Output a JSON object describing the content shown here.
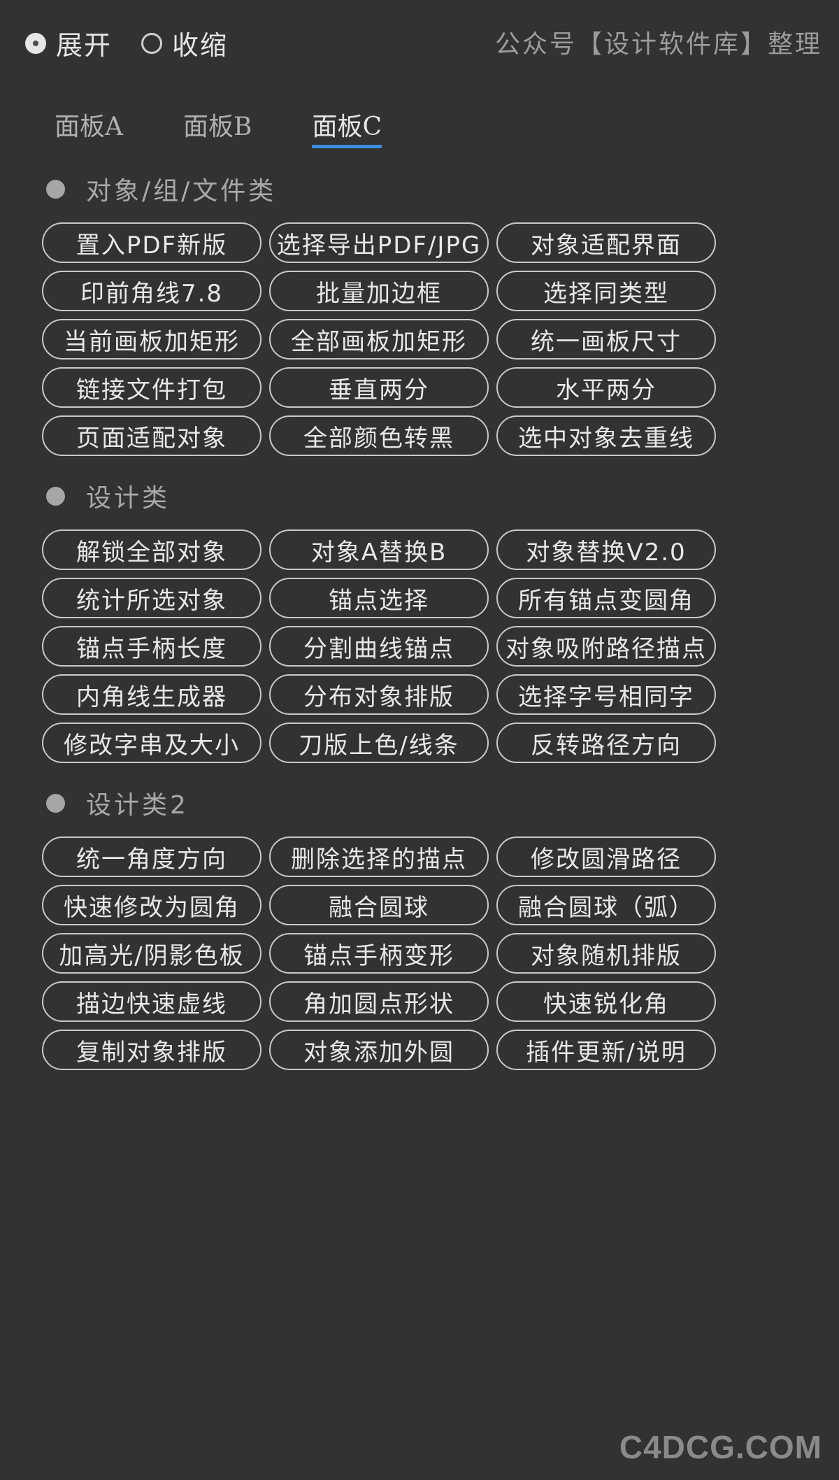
{
  "mode": {
    "expand_label": "展开",
    "collapse_label": "收缩",
    "selected": "expand"
  },
  "credit": "公众号【设计软件库】整理",
  "tabs": [
    {
      "label": "面板A",
      "active": false
    },
    {
      "label": "面板B",
      "active": false
    },
    {
      "label": "面板C",
      "active": true
    }
  ],
  "sections": [
    {
      "title": "对象/组/文件类",
      "buttons": [
        "置入PDF新版",
        "选择导出PDF/JPG",
        "对象适配界面",
        "印前角线7.8",
        "批量加边框",
        "选择同类型",
        "当前画板加矩形",
        "全部画板加矩形",
        "统一画板尺寸",
        "链接文件打包",
        "垂直两分",
        "水平两分",
        "页面适配对象",
        "全部颜色转黑",
        "选中对象去重线"
      ]
    },
    {
      "title": "设计类",
      "buttons": [
        "解锁全部对象",
        "对象A替换B",
        "对象替换V2.0",
        "统计所选对象",
        "锚点选择",
        "所有锚点变圆角",
        "锚点手柄长度",
        "分割曲线锚点",
        "对象吸附路径描点",
        "内角线生成器",
        "分布对象排版",
        "选择字号相同字",
        "修改字串及大小",
        "刀版上色/线条",
        "反转路径方向"
      ]
    },
    {
      "title": "设计类2",
      "buttons": [
        "统一角度方向",
        "删除选择的描点",
        "修改圆滑路径",
        "快速修改为圆角",
        "融合圆球",
        "融合圆球（弧）",
        "加高光/阴影色板",
        "锚点手柄变形",
        "对象随机排版",
        "描边快速虚线",
        "角加圆点形状",
        "快速锐化角",
        "复制对象排版",
        "对象添加外圆",
        "插件更新/说明"
      ]
    }
  ],
  "watermark": "C4DCG.COM"
}
